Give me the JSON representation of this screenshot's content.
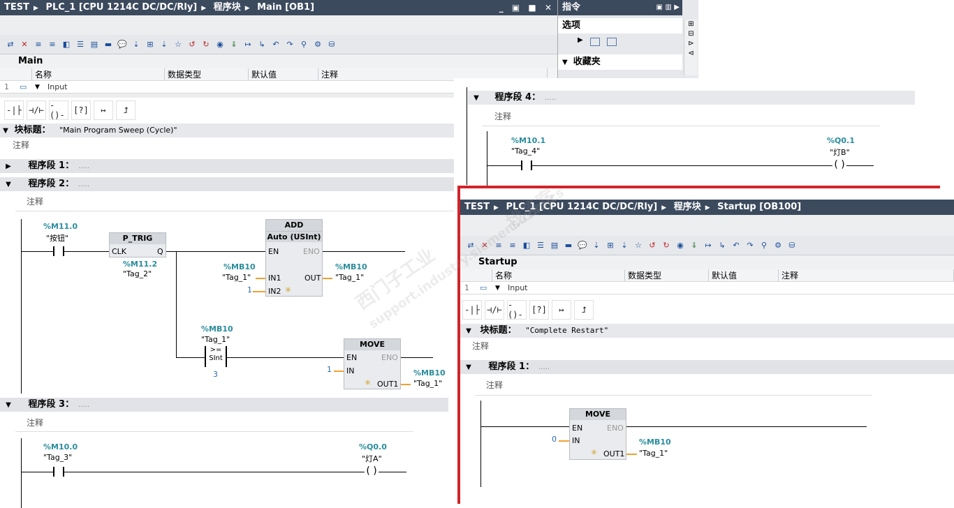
{
  "main_window": {
    "breadcrumb": [
      "TEST",
      "PLC_1 [CPU 1214C DC/DC/Rly]",
      "程序块",
      "Main [OB1]"
    ],
    "block_name": "Main",
    "interface_headers": [
      "名称",
      "数据类型",
      "默认值",
      "注释"
    ],
    "interface_row": {
      "index": "1",
      "name": "Input"
    },
    "block_title_label": "块标题：",
    "block_title_value": "\"Main Program Sweep (Cycle)\"",
    "comment": "注释",
    "segments": [
      {
        "label": "程序段 1：",
        "dots": "....."
      },
      {
        "label": "程序段 2：",
        "dots": "....."
      },
      {
        "label": "程序段 3：",
        "dots": "....."
      }
    ],
    "seg2": {
      "contact_addr": "%M11.0",
      "contact_tag": "\"按钮\"",
      "ptrig_title": "P_TRIG",
      "ptrig_clk": "CLK",
      "ptrig_q": "Q",
      "ptrig_addr": "%M11.2",
      "ptrig_tag": "\"Tag_2\"",
      "add_title": "ADD",
      "add_type": "Auto (USInt)",
      "en": "EN",
      "eno": "ENO",
      "in1": "IN1",
      "in2": "IN2",
      "out": "OUT",
      "in1_addr": "%MB10",
      "in1_tag": "\"Tag_1\"",
      "in2_val": "1",
      "out_addr": "%MB10",
      "out_tag": "\"Tag_1\"",
      "cmp_addr": "%MB10",
      "cmp_tag": "\"Tag_1\"",
      "cmp_op": ">=",
      "cmp_type": "SInt",
      "cmp_val": "3",
      "move_title": "MOVE",
      "move_in": "IN",
      "move_out": "OUT1",
      "move_in_val": "1",
      "move_out_addr": "%MB10",
      "move_out_tag": "\"Tag_1\""
    },
    "seg3": {
      "contact_addr": "%M10.0",
      "contact_tag": "\"Tag_3\"",
      "coil_addr": "%Q0.0",
      "coil_tag": "\"灯A\""
    }
  },
  "instructions_panel": {
    "title": "指令",
    "options": "选项",
    "favorites": "收藏夹"
  },
  "overlay_seg4": {
    "label": "程序段 4：",
    "dots": ".....",
    "comment": "注释",
    "contact_addr": "%M10.1",
    "contact_tag": "\"Tag_4\"",
    "coil_addr": "%Q0.1",
    "coil_tag": "\"灯B\""
  },
  "startup_window": {
    "breadcrumb": [
      "TEST",
      "PLC_1 [CPU 1214C DC/DC/Rly]",
      "程序块",
      "Startup [OB100]"
    ],
    "block_name": "Startup",
    "interface_headers": [
      "名称",
      "数据类型",
      "默认值",
      "注释"
    ],
    "interface_row": {
      "index": "1",
      "name": "Input"
    },
    "block_title_label": "块标题：",
    "block_title_value": "\"Complete Restart\"",
    "comment": "注释",
    "segment": {
      "label": "程序段 1：",
      "dots": "....."
    },
    "move": {
      "title": "MOVE",
      "en": "EN",
      "eno": "ENO",
      "in": "IN",
      "out": "OUT1",
      "in_val": "0",
      "out_addr": "%MB10",
      "out_tag": "\"Tag_1\""
    }
  },
  "watermark": [
    "西门子工业",
    "找答案",
    "support.industry.siemens.com/cs"
  ],
  "colors": {
    "accent_red": "#d3232a",
    "titlebar": "#3c4a5e",
    "address_teal": "#2a8d9c",
    "wire_orange": "#f0a030"
  }
}
